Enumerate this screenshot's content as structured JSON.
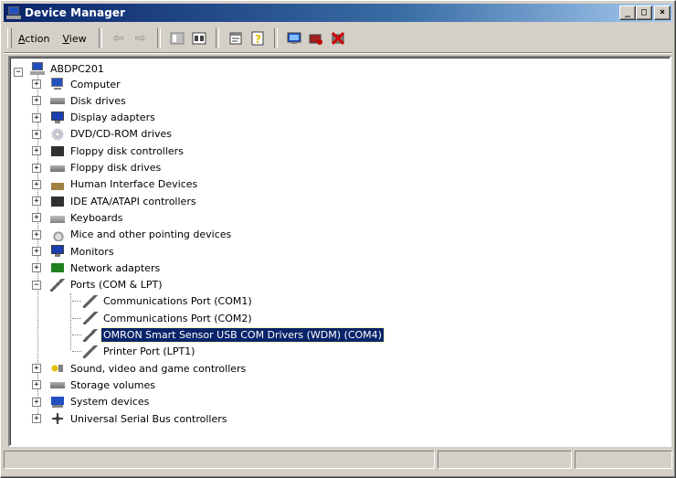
{
  "window": {
    "title": "Device Manager",
    "controls": {
      "minimize": "_",
      "maximize": "□",
      "close": "×"
    }
  },
  "menu": {
    "action": {
      "accel": "A",
      "rest": "ction"
    },
    "view": {
      "accel": "V",
      "rest": "iew"
    }
  },
  "toolbar": {
    "buttons": [
      "back-icon",
      "forward-icon",
      "console-tree-icon",
      "show-hide-icon",
      "properties-icon",
      "help-icon",
      "scan-hardware-icon",
      "disable-device-icon",
      "uninstall-device-icon"
    ],
    "arrows": {
      "back": "⇦",
      "forward": "⇨"
    },
    "help_glyph": "?"
  },
  "tree": {
    "root": {
      "label": "ABDPC201",
      "expander": "−"
    },
    "collapsed_symbol": "+",
    "expanded_symbol": "−",
    "categories": [
      {
        "label": "Computer",
        "icon": "computer-icon"
      },
      {
        "label": "Disk drives",
        "icon": "disk-drive-icon"
      },
      {
        "label": "Display adapters",
        "icon": "display-adapter-icon"
      },
      {
        "label": "DVD/CD-ROM drives",
        "icon": "cdrom-icon"
      },
      {
        "label": "Floppy disk controllers",
        "icon": "floppy-controller-icon"
      },
      {
        "label": "Floppy disk drives",
        "icon": "floppy-drive-icon"
      },
      {
        "label": "Human Interface Devices",
        "icon": "hid-icon"
      },
      {
        "label": "IDE ATA/ATAPI controllers",
        "icon": "ide-controller-icon"
      },
      {
        "label": "Keyboards",
        "icon": "keyboard-icon"
      },
      {
        "label": "Mice and other pointing devices",
        "icon": "mouse-icon"
      },
      {
        "label": "Monitors",
        "icon": "monitor-icon"
      },
      {
        "label": "Network adapters",
        "icon": "network-adapter-icon"
      },
      {
        "label": "Ports (COM & LPT)",
        "icon": "port-icon",
        "expanded": true
      },
      {
        "label": "Sound, video and game controllers",
        "icon": "sound-icon"
      },
      {
        "label": "Storage volumes",
        "icon": "storage-volume-icon"
      },
      {
        "label": "System devices",
        "icon": "system-device-icon"
      },
      {
        "label": "Universal Serial Bus controllers",
        "icon": "usb-icon"
      }
    ],
    "ports_children": [
      {
        "label": "Communications Port (COM1)",
        "selected": false
      },
      {
        "label": "Communications Port (COM2)",
        "selected": false
      },
      {
        "label": "OMRON Smart Sensor USB COM Drivers (WDM) (COM4)",
        "selected": true
      },
      {
        "label": "Printer Port (LPT1)",
        "selected": false
      }
    ]
  },
  "colors": {
    "selection": "#0a246a",
    "title_gradient_start": "#0a246a",
    "title_gradient_end": "#a6caf0"
  }
}
